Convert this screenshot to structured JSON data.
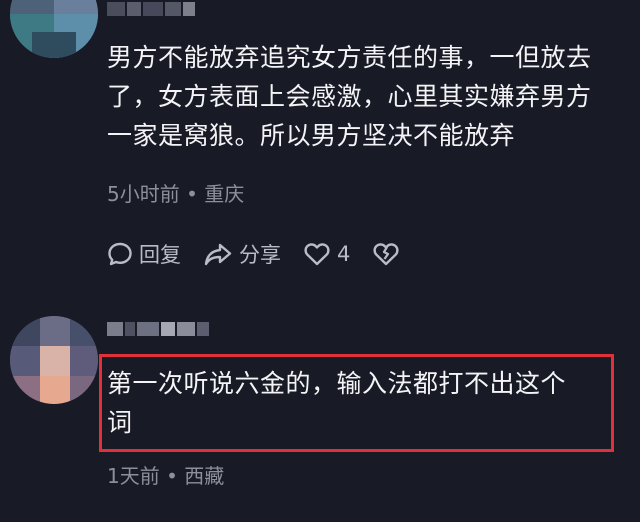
{
  "comments": [
    {
      "text_lines": [
        "男方不能放弃追究女方责任的事，一但放去",
        "了，女方表面上会感激，心里其实嫌弃男方",
        "一家是窝狼。所以男方坚决不能放弃"
      ],
      "meta": "5小时前 • 重庆",
      "actions": {
        "reply_label": "回复",
        "share_label": "分享",
        "like_count": "4"
      },
      "icons": [
        "comment-bubble-icon",
        "share-arrow-icon",
        "heart-icon",
        "broken-heart-icon"
      ]
    },
    {
      "text_lines": [
        "第一次听说六金的，输入法都打不出这个",
        "词"
      ],
      "meta": "1天前 • 西藏",
      "highlight_color": "#e0313a"
    }
  ],
  "colors": {
    "background": "#181a26",
    "text": "#f4f4f6",
    "meta": "#8c8f9c",
    "highlight": "#e0313a"
  }
}
